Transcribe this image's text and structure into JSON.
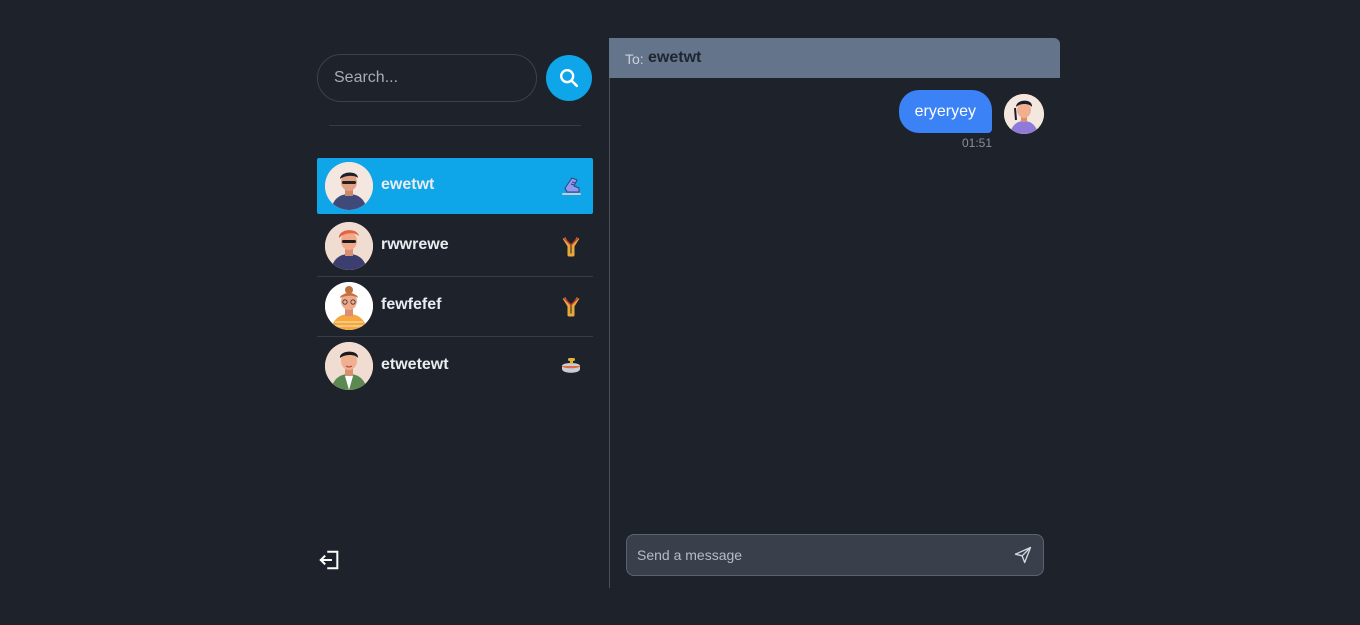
{
  "search": {
    "placeholder": "Search..."
  },
  "conversations": [
    {
      "name": "ewetwt",
      "emoji_icon": "ice-skate-icon",
      "active": true
    },
    {
      "name": "rwwrewe",
      "emoji_icon": "slingshot-icon",
      "active": false
    },
    {
      "name": "fewfefef",
      "emoji_icon": "slingshot-icon",
      "active": false
    },
    {
      "name": "etwetewt",
      "emoji_icon": "curling-stone-icon",
      "active": false
    }
  ],
  "chat": {
    "to_label": "To:",
    "to_name": "ewetwt",
    "messages": [
      {
        "text": "eryeryey",
        "time": "01:51",
        "from_me": true
      }
    ],
    "composer_placeholder": "Send a message"
  },
  "colors": {
    "background": "#1e222a",
    "accent": "#0ea5e9",
    "header": "#64748b",
    "bubble": "#3b82f6"
  }
}
